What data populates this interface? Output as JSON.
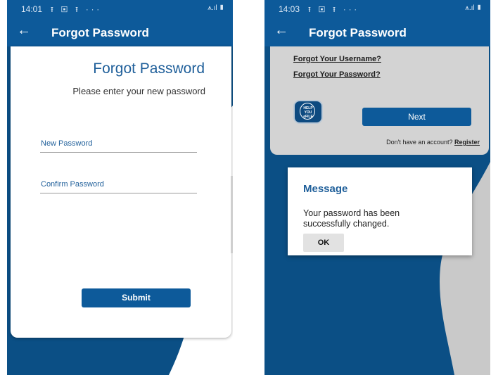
{
  "left": {
    "status_time": "14:01",
    "status_icons": "⭱ ▣ ⭱ ···",
    "status_system": "⩚.ıl ▮",
    "back_icon": "←",
    "appbar_title": "Forgot Password",
    "card_title": "Forgot Password",
    "card_subtitle": "Please enter your new password",
    "new_password_placeholder": "New Password",
    "confirm_password_placeholder": "Confirm Password",
    "submit_label": "Submit"
  },
  "right": {
    "status_time": "14:03",
    "status_icons": "⭱ ▣ ⭱ ···",
    "status_system": "⩚.ıl ▮",
    "back_icon": "←",
    "appbar_title": "Forgot Password",
    "link_username": "Forgot Your Username?",
    "link_password": "Forgot Your Password?",
    "logo_text": [
      "HELP",
      "YOU",
      "eFILE"
    ],
    "next_label": "Next",
    "no_account_text": "Don't have an account?",
    "register_link": "Register",
    "dialog": {
      "title": "Message",
      "message": "Your password has been successfully changed.",
      "ok_label": "OK"
    }
  },
  "colors": {
    "primary": "#0d5a9a",
    "background_dark": "#0b4f85",
    "accent_text": "#1f5f9a",
    "card_grey": "#d3d3d3"
  },
  "icons": {
    "back": "arrow-left-icon",
    "logo": "help-you-efile-logo"
  }
}
